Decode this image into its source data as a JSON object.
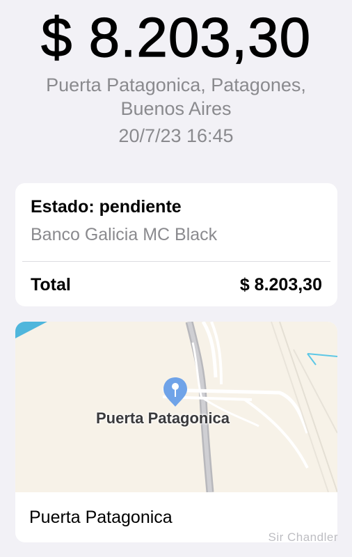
{
  "transaction": {
    "amount": "$ 8.203,30",
    "merchant_line1": "Puerta Patagonica, Patagones,",
    "merchant_line2": "Buenos Aires",
    "datetime": "20/7/23 16:45"
  },
  "status_card": {
    "status": "Estado: pendiente",
    "card_name": "Banco Galicia MC Black",
    "total_label": "Total",
    "total_value": "$ 8.203,30"
  },
  "map_card": {
    "map_pin_label": "Puerta Patagonica",
    "footer_label": "Puerta Patagonica",
    "pin_icon": "map-pin-icon"
  },
  "watermark": "Sir Chandler",
  "colors": {
    "background": "#f2f1f6",
    "secondary_text": "#8a8a8e",
    "map_land": "#f7f2e8",
    "map_water": "#4fb6dc",
    "pin": "#6fa3e8"
  }
}
